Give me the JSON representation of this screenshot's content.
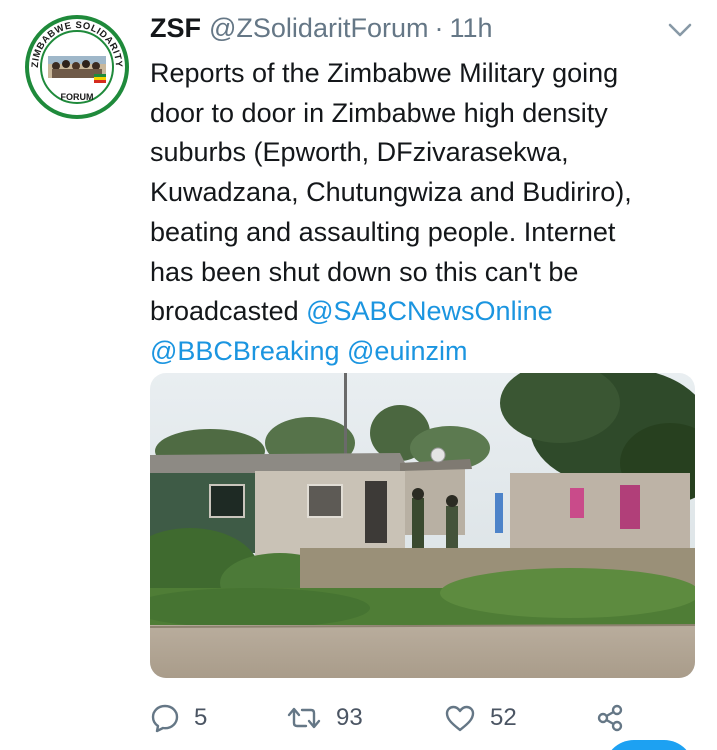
{
  "tweet": {
    "display_name": "ZSF",
    "handle": "@ZSolidaritForum",
    "separator": "·",
    "time": "11h",
    "text_plain": "Reports of the Zimbabwe Military going\ndoor to door in Zimbabwe high density\nsuburbs (Epworth, DFzivarasekwa,\nKuwadzana, Chutungwiza and Budiriro),\nbeating and assaulting people. Internet\nhas been shut down so this can't be\nbroadcasted ",
    "mention_1": "@SABCNewsOnline",
    "mention_2": "@BBCBreaking",
    "mention_3": "@euinzim",
    "avatar_logo_text": "ZIMBABWE SOLIDARITY",
    "avatar_logo_text_bottom": "FORUM"
  },
  "actions": {
    "reply_count": "5",
    "retweet_count": "93",
    "like_count": "52"
  },
  "icons": {
    "reply": "reply-icon",
    "retweet": "retweet-icon",
    "like": "like-icon",
    "share": "share-icon",
    "caret": "chevron-down-icon"
  },
  "colors": {
    "link": "#1b95e0",
    "secondary": "#657786",
    "accent": "#1da1f2",
    "logo_green": "#1f8a3b"
  }
}
